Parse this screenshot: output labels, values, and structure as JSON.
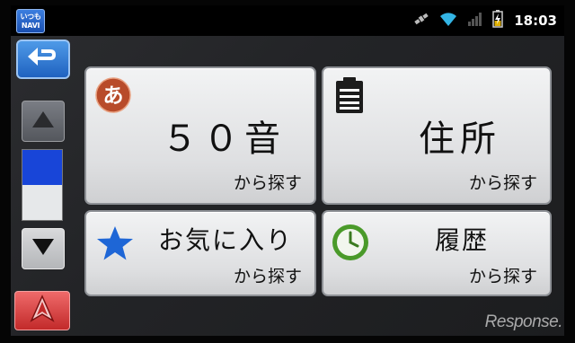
{
  "status_bar": {
    "app_logo_line1": "いつも",
    "app_logo_line2": "NAVI",
    "time": "18:03"
  },
  "nav": {
    "back_icon": "return-arrow-icon",
    "scroll_up_icon": "triangle-up-icon",
    "scroll_down_icon": "triangle-down-icon",
    "navigation_icon": "navigation-arrow-icon",
    "scroll_position_fraction": 0.5
  },
  "menu": {
    "items": [
      {
        "title": "５０音",
        "subtitle": "から探す",
        "icon": "hiragana-a-icon"
      },
      {
        "title": "住所",
        "subtitle": "から探す",
        "icon": "address-book-icon"
      },
      {
        "title": "お気に入り",
        "subtitle": "から探す",
        "icon": "star-icon"
      },
      {
        "title": "履歴",
        "subtitle": "から探す",
        "icon": "clock-icon"
      }
    ]
  },
  "watermark": "Response.",
  "colors": {
    "accent_blue": "#1f62c0",
    "nav_red": "#c22a2a",
    "card_bg": "#e6e7e9"
  }
}
